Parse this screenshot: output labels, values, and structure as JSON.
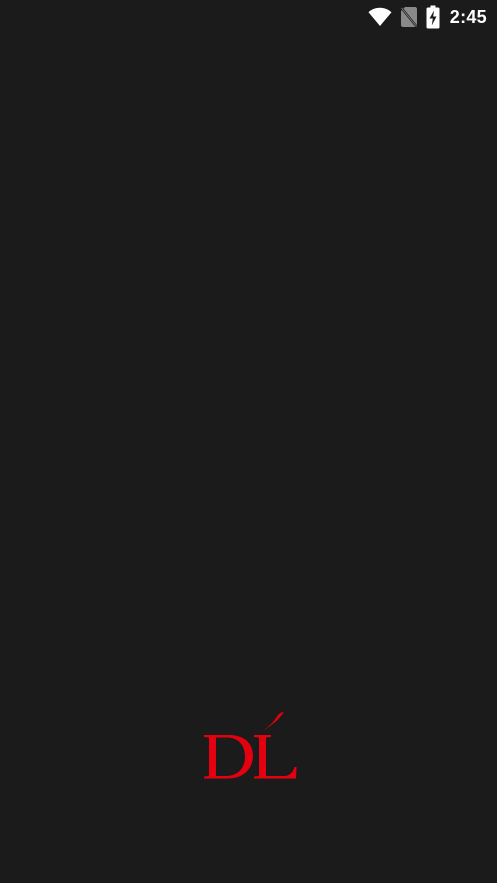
{
  "status_bar": {
    "time": "2:45",
    "icons": [
      "wifi-icon",
      "no-sim-icon",
      "battery-charging-icon"
    ]
  },
  "splash": {
    "logo_text": "DĹ",
    "logo_color": "#e3000f",
    "background_color": "#1b1b1b"
  }
}
